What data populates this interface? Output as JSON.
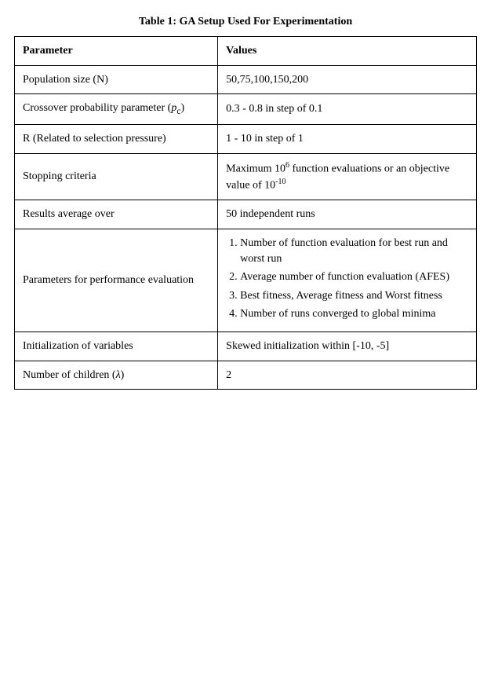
{
  "title": "Table 1: GA Setup Used For Experimentation",
  "table": {
    "headers": [
      "Parameter",
      "Values"
    ],
    "rows": [
      {
        "param": "Population size (N)",
        "value_text": "50,75,100,150,200",
        "value_type": "plain"
      },
      {
        "param_prefix": "Crossover probability parameter (",
        "param_italic": "p",
        "param_sub": "c",
        "param_suffix": ")",
        "value_text": "0.3 - 0.8 in step of 0.1",
        "value_type": "plain"
      },
      {
        "param": "R (Related to selection pressure)",
        "value_text": "1 - 10 in step of 1",
        "value_type": "plain"
      },
      {
        "param": "Stopping criteria",
        "value_type": "stopping",
        "value_text": "Maximum 10",
        "value_sup": "6",
        "value_text2": " function evaluations or an objective value of 10",
        "value_sup2": "-10"
      },
      {
        "param": "Results average over",
        "value_text": "50 independent runs",
        "value_type": "plain"
      },
      {
        "param": "Parameters for performance evaluation",
        "value_type": "list",
        "list_items": [
          "Number of function evaluation for best run and worst run",
          "Average number of function evaluation (AFES)",
          "Best fitness, Average fitness and Worst fitness",
          "Number of runs converged to global minima"
        ]
      },
      {
        "param": "Initialization of variables",
        "value_text": "Skewed initialization within [-10, -5]",
        "value_type": "plain"
      },
      {
        "param_prefix": "Number of children (",
        "param_italic": "λ",
        "param_suffix": ")",
        "value_text": "2",
        "value_type": "plain"
      }
    ]
  }
}
